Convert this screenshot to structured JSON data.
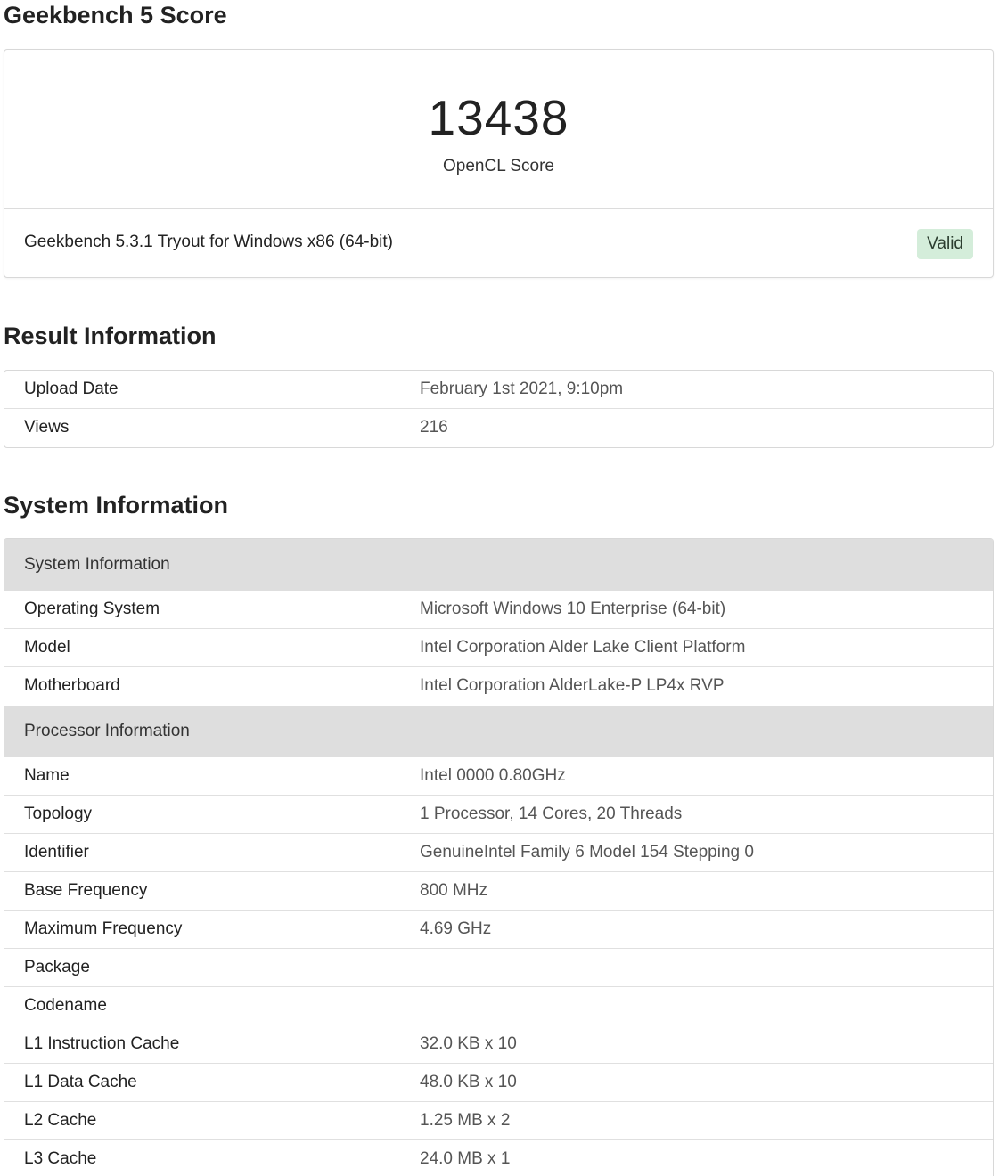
{
  "score_section": {
    "title": "Geekbench 5 Score",
    "score": "13438",
    "score_label": "OpenCL Score",
    "version": "Geekbench 5.3.1 Tryout for Windows x86 (64-bit)",
    "badge": "Valid",
    "badge_color": "#d4edda"
  },
  "result_section": {
    "title": "Result Information",
    "rows": [
      {
        "label": "Upload Date",
        "value": "February 1st 2021, 9:10pm"
      },
      {
        "label": "Views",
        "value": "216"
      }
    ]
  },
  "system_section": {
    "title": "System Information",
    "groups": [
      {
        "header": "System Information",
        "rows": [
          {
            "label": "Operating System",
            "value": "Microsoft Windows 10 Enterprise (64-bit)"
          },
          {
            "label": "Model",
            "value": "Intel Corporation Alder Lake Client Platform"
          },
          {
            "label": "Motherboard",
            "value": "Intel Corporation AlderLake-P LP4x RVP"
          }
        ]
      },
      {
        "header": "Processor Information",
        "rows": [
          {
            "label": "Name",
            "value": "Intel 0000 0.80GHz"
          },
          {
            "label": "Topology",
            "value": "1 Processor, 14 Cores, 20 Threads"
          },
          {
            "label": "Identifier",
            "value": "GenuineIntel Family 6 Model 154 Stepping 0"
          },
          {
            "label": "Base Frequency",
            "value": "800 MHz"
          },
          {
            "label": "Maximum Frequency",
            "value": "4.69 GHz"
          },
          {
            "label": "Package",
            "value": ""
          },
          {
            "label": "Codename",
            "value": ""
          },
          {
            "label": "L1 Instruction Cache",
            "value": "32.0 KB x 10"
          },
          {
            "label": "L1 Data Cache",
            "value": "48.0 KB x 10"
          },
          {
            "label": "L2 Cache",
            "value": "1.25 MB x 2"
          },
          {
            "label": "L3 Cache",
            "value": "24.0 MB x 1"
          }
        ]
      }
    ]
  }
}
